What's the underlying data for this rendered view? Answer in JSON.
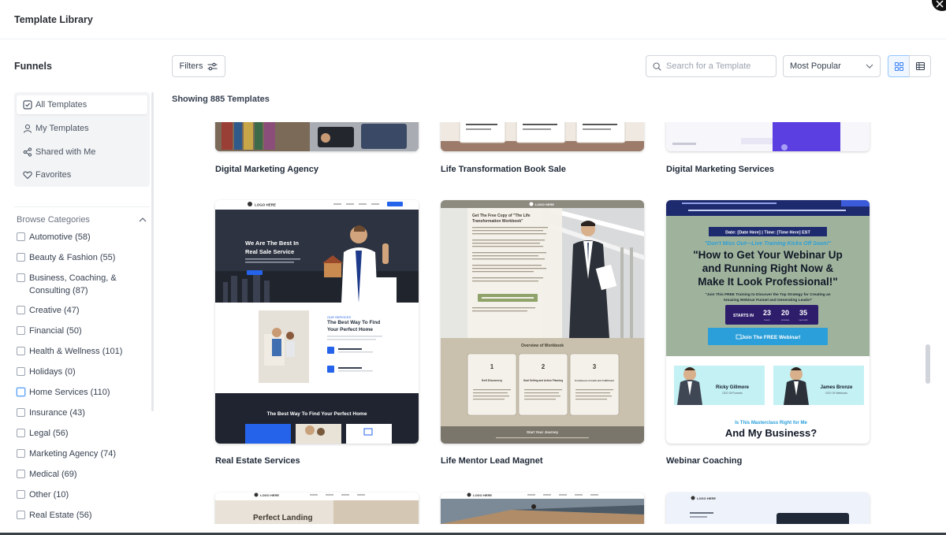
{
  "window": {
    "title": "Template Library"
  },
  "sidebar": {
    "heading": "Funnels",
    "nav": [
      {
        "label": "All Templates",
        "icon": "checkbox-icon",
        "active": true
      },
      {
        "label": "My Templates",
        "icon": "user-icon",
        "active": false
      },
      {
        "label": "Shared with Me",
        "icon": "share-icon",
        "active": false
      },
      {
        "label": "Favorites",
        "icon": "heart-icon",
        "active": false
      }
    ],
    "categories_heading": "Browse Categories",
    "categories": [
      "Automotive (58)",
      "Beauty & Fashion (55)",
      "Business, Coaching, & Consulting (87)",
      "Creative (47)",
      "Financial (50)",
      "Health & Wellness (101)",
      "Holidays (0)",
      "Home Services (110)",
      "Insurance (43)",
      "Legal (56)",
      "Marketing Agency (74)",
      "Medical (69)",
      "Other (10)",
      "Real Estate (56)"
    ]
  },
  "toolbar": {
    "filters_label": "Filters",
    "search_placeholder": "Search for a Template",
    "sort_value": "Most Popular"
  },
  "results": {
    "count_text": "Showing 885 Templates"
  },
  "templates": [
    {
      "name": "Digital Marketing Agency"
    },
    {
      "name": "Life Transformation Book Sale"
    },
    {
      "name": "Digital Marketing Services"
    },
    {
      "name": "Real Estate Services",
      "preview": {
        "logo": "LOGO HERE",
        "hero_title_line1": "We Are The Best In",
        "hero_title_line2": "Real Sale Service",
        "section_title_line1": "The Best Way To Find",
        "section_title_line2": "Your Perfect Home",
        "footer_title": "The Best Way To Find Your Perfect Home"
      }
    },
    {
      "name": "Life Mentor Lead Magnet",
      "preview": {
        "logo": "LOGO HERE",
        "headline_line1": "Get The Free Copy of \"The Life",
        "headline_line2": "Transformation Workbook\"",
        "overview": "Overview of Workbook",
        "steps": [
          "1",
          "2",
          "3"
        ],
        "step_titles": [
          "Self Discovery",
          "Goal Setting and Action Planning",
          "Continuous Growth and Fulfillment"
        ],
        "footer": "Start Your Journey"
      }
    },
    {
      "name": "Webinar Coaching",
      "preview": {
        "date_line": "Date: [Date Here] | Time: [Time Here] EST",
        "kicker": "\"Don't Miss Out—Live Training Kicks Off Soon!\"",
        "headline_line1": "\"How to Get Your Webinar Up",
        "headline_line2": "and Running Right Now &",
        "headline_line3": "Make It Look Professional!\"",
        "sub_line1": "\"Join This FREE Training to Discover the Top Strategy for Creating an",
        "sub_line2": "Amazing Webinar Funnel and Generating Leads!\"",
        "starts_in": "STARTS IN",
        "countdown": [
          {
            "value": "23",
            "unit": "hours"
          },
          {
            "value": "20",
            "unit": "minutes"
          },
          {
            "value": "35",
            "unit": "seconds"
          }
        ],
        "cta": "Join The FREE Webinar!",
        "hosts": [
          {
            "name": "Ricky Gillmore",
            "role": "CEO Of Funnels"
          },
          {
            "name": "James Bronze",
            "role": "CEO Of Webinars"
          }
        ],
        "question": "Is This Masterclass Right for Me",
        "bottom_headline": "And My Business?"
      }
    },
    {
      "name": "",
      "preview": {
        "logo": "LOGO HERE",
        "title": "Perfect Landing"
      }
    },
    {
      "name": "",
      "preview": {
        "logo": "LOGO HERE"
      }
    },
    {
      "name": "",
      "preview": {
        "logo": "LOGO HERE"
      }
    }
  ],
  "colors": {
    "accent": "#3b82f6",
    "webinar_navy": "#1e2a6e",
    "webinar_green": "#9fb39c",
    "webinar_cyan": "#2b9fd9",
    "realestate_dark": "#2d3340",
    "mentor_tan": "#c9c1ad"
  }
}
